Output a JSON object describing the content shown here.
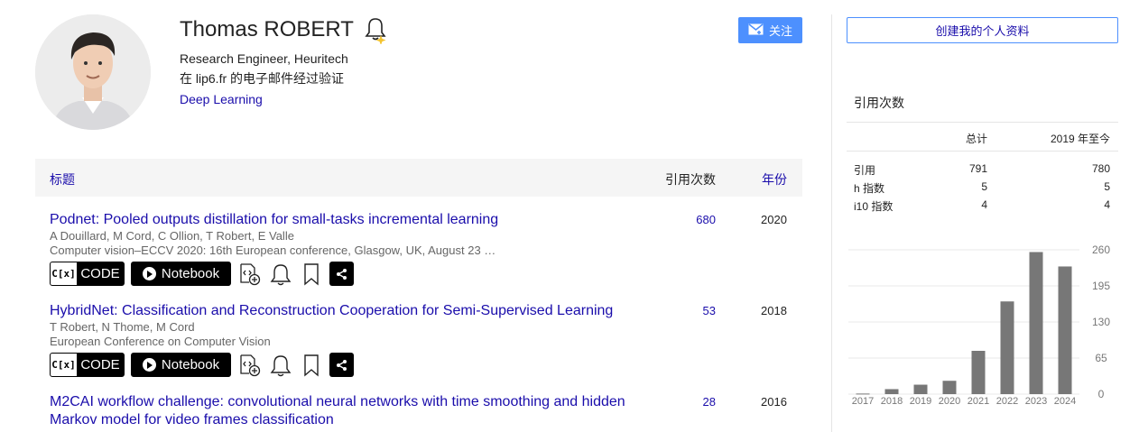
{
  "profile": {
    "name": "Thomas ROBERT",
    "affiliation": "Research Engineer, Heuritech",
    "verified_email": "在 lip6.fr 的电子邮件经过验证",
    "interest": "Deep Learning",
    "follow_label": "关注",
    "create_profile_label": "创建我的个人资料"
  },
  "table": {
    "col_title": "标题",
    "col_cited_by": "引用次数",
    "col_year": "年份"
  },
  "articles": [
    {
      "title": "Podnet: Pooled outputs distillation for small-tasks incremental learning",
      "authors": "A Douillard, M Cord, C Ollion, T Robert, E Valle",
      "venue": "Computer vision–ECCV 2020: 16th European conference, Glasgow, UK, August 23 …",
      "cites": "680",
      "year": "2020",
      "code_label": "CODE",
      "code_icon": "C[x]",
      "notebook_label": "Notebook"
    },
    {
      "title": "HybridNet: Classification and Reconstruction Cooperation for Semi-Supervised Learning",
      "authors": "T Robert, N Thome, M Cord",
      "venue": "European Conference on Computer Vision",
      "cites": "53",
      "year": "2018",
      "code_label": "CODE",
      "code_icon": "C[x]",
      "notebook_label": "Notebook"
    },
    {
      "title": "M2CAI workflow challenge: convolutional neural networks with time smoothing and hidden Markov model for video frames classification",
      "cites": "28",
      "year": "2016"
    }
  ],
  "citations": {
    "title": "引用次数",
    "col_all": "总计",
    "col_since": "2019 年至今",
    "rows": [
      {
        "label": "引用",
        "all": "791",
        "since": "780"
      },
      {
        "label": "h 指数",
        "all": "5",
        "since": "5"
      },
      {
        "label": "i10 指数",
        "all": "4",
        "since": "4"
      }
    ]
  },
  "chart_data": {
    "type": "bar",
    "categories": [
      "2017",
      "2018",
      "2019",
      "2020",
      "2021",
      "2022",
      "2023",
      "2024"
    ],
    "values": [
      1,
      9,
      17,
      24,
      78,
      167,
      256,
      230
    ],
    "ylim": [
      0,
      260
    ],
    "yticks": [
      "0",
      "65",
      "130",
      "195",
      "260"
    ],
    "bar_color": "#777777"
  },
  "colors": {
    "link": "#1a0dab",
    "accent": "#4d90fe"
  }
}
